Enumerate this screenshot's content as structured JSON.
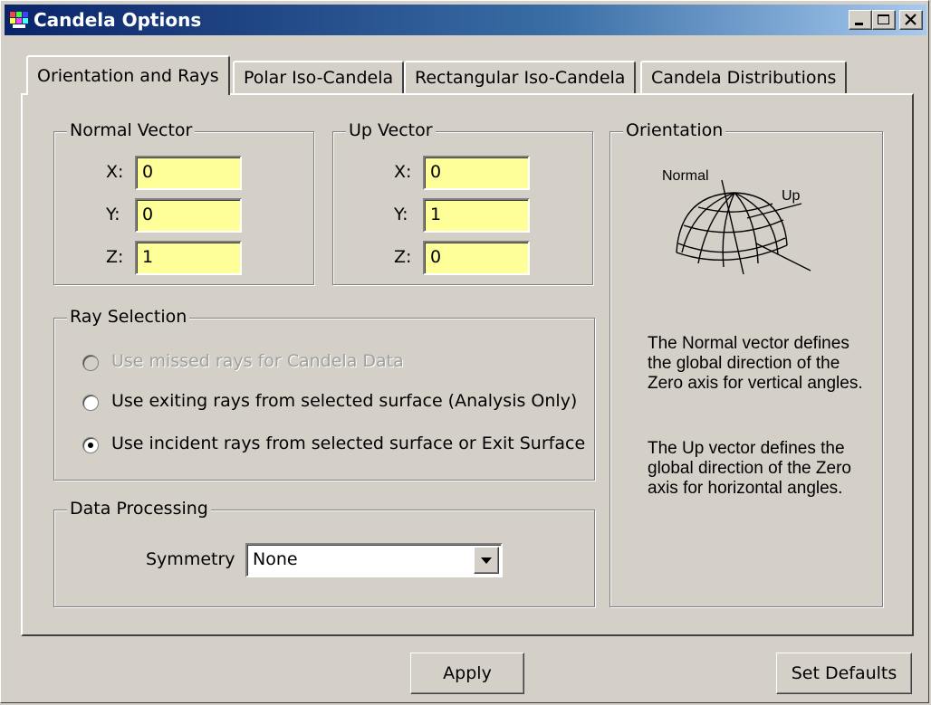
{
  "window": {
    "title": "Candela Options"
  },
  "tabs": [
    {
      "label": "Orientation and Rays",
      "active": true
    },
    {
      "label": "Polar Iso-Candela",
      "active": false
    },
    {
      "label": "Rectangular Iso-Candela",
      "active": false
    },
    {
      "label": "Candela Distributions",
      "active": false
    }
  ],
  "normal_vector": {
    "title": "Normal Vector",
    "x_label": "X:",
    "y_label": "Y:",
    "z_label": "Z:",
    "x": "0",
    "y": "0",
    "z": "1"
  },
  "up_vector": {
    "title": "Up Vector",
    "x_label": "X:",
    "y_label": "Y:",
    "z_label": "Z:",
    "x": "0",
    "y": "1",
    "z": "0"
  },
  "ray_selection": {
    "title": "Ray Selection",
    "options": [
      {
        "label": "Use missed rays for Candela Data",
        "enabled": false,
        "checked": false
      },
      {
        "label": "Use exiting rays from selected surface (Analysis Only)",
        "enabled": true,
        "checked": false
      },
      {
        "label": "Use incident rays from selected surface or Exit Surface",
        "enabled": true,
        "checked": true
      }
    ]
  },
  "data_processing": {
    "title": "Data Processing",
    "symmetry_label": "Symmetry",
    "symmetry_value": "None"
  },
  "orientation": {
    "title": "Orientation",
    "normal_label": "Normal",
    "up_label": "Up",
    "normal_text": "The Normal vector defines the global direction of the Zero axis for vertical angles.",
    "up_text": "The Up vector defines the global direction of the Zero axis for horizontal angles."
  },
  "buttons": {
    "apply": "Apply",
    "set_defaults": "Set Defaults"
  },
  "colors": {
    "field_bg": "#ffff99",
    "title_bar_start": "#0a246a",
    "title_bar_end": "#a6caf0",
    "dialog_bg": "#d4d0c8"
  }
}
